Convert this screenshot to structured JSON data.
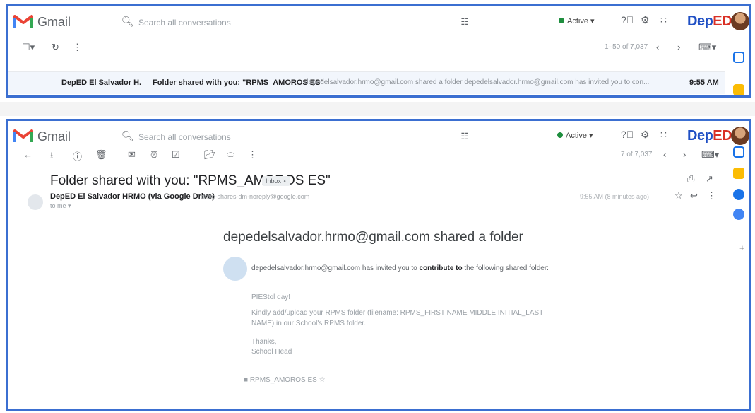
{
  "top": {
    "app_name": "Gmail",
    "search_placeholder": "Search all conversations",
    "status": "Active",
    "brand_a": "Dep",
    "brand_b": "ED",
    "pager": "1–50 of 7,037",
    "email": {
      "sender": "DepED El Salvador H.",
      "subject": "Folder shared with you: \"RPMS_AMOROS ES\"",
      "snippet": "depedelsalvador.hrmo@gmail.com shared a folder depedelsalvador.hrmo@gmail.com has invited you to con...",
      "time": "9:55 AM"
    }
  },
  "bottom": {
    "app_name": "Gmail",
    "search_placeholder": "Search all conversations",
    "status": "Active",
    "brand_a": "Dep",
    "brand_b": "ED",
    "pager": "7 of 7,037",
    "thread": {
      "subject": "Folder shared with you: \"RPMS_AMOROS ES\"",
      "tag": "Inbox ×",
      "from": "DepED El Salvador HRMO (via Google Drive)",
      "from_email": "drive-shares-dm-noreply@google.com",
      "to": "to me ▾",
      "time": "9:55 AM (8 minutes ago)"
    },
    "card": {
      "title": "depedelsalvador.hrmo@gmail.com shared a folder",
      "invite_prefix": "depedelsalvador.hrmo@gmail.com has invited you to",
      "invite_bold": "contribute to",
      "invite_suffix": "the following shared folder:",
      "p1": "PIEStol day!",
      "p2": "Kindly add/upload your RPMS folder (filename: RPMS_FIRST NAME MIDDLE INITIAL_LAST NAME) in our School's RPMS folder.",
      "p3a": "Thanks,",
      "p3b": "School Head",
      "folder_name": "RPMS_AMOROS ES"
    }
  },
  "colors": {
    "frame": "#3b6fd1",
    "active": "#1e8e3e",
    "brand": "#1f4fc4",
    "brand_accent": "#d93025"
  }
}
